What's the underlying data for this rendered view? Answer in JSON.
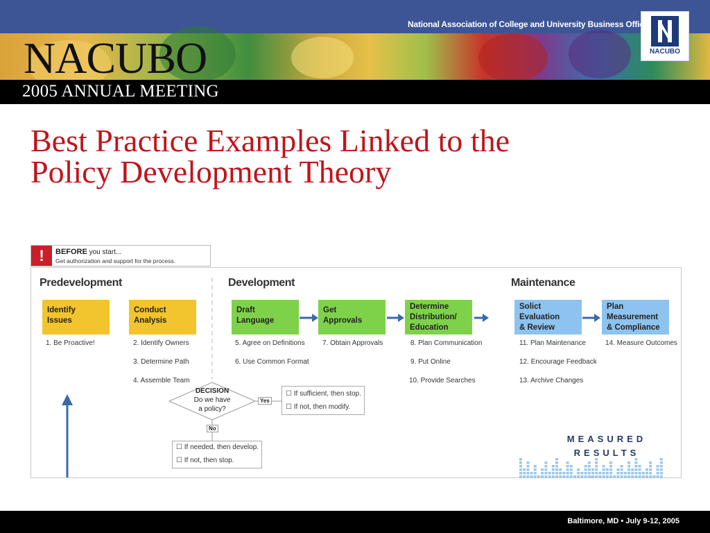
{
  "header": {
    "association": "National Association of College and University Business Officers",
    "wordmark": "NACUBO",
    "meeting": "2005 ANNUAL MEETING",
    "logo_label": "NACUBO"
  },
  "title": {
    "line1": "Best Practice Examples Linked to the",
    "line2": "Policy Development Theory"
  },
  "before": {
    "mark": "!",
    "heading": "BEFORE",
    "heading_rest": "you start...",
    "text": "Get authorization and support for the process."
  },
  "phases": {
    "predevelopment": "Predevelopment",
    "development": "Development",
    "maintenance": "Maintenance"
  },
  "steps": [
    {
      "line1": "Identify",
      "line2": "Issues",
      "line3": ""
    },
    {
      "line1": "Conduct",
      "line2": "Analysis",
      "line3": ""
    },
    {
      "line1": "Draft",
      "line2": "Language",
      "line3": ""
    },
    {
      "line1": "Get",
      "line2": "Approvals",
      "line3": ""
    },
    {
      "line1": "Determine",
      "line2": "Distribution/",
      "line3": "Education"
    },
    {
      "line1": "Solict",
      "line2": "Evaluation",
      "line3": "& Review"
    },
    {
      "line1": "Plan",
      "line2": "Measurement",
      "line3": "& Compliance"
    }
  ],
  "items": [
    "1. Be Proactive!",
    "2. Identify Owners",
    "3. Determine Path",
    "4. Assemble Team",
    "5. Agree on Definitions",
    "6. Use Common Format",
    "7. Obtain Approvals",
    "8. Plan Communication",
    "9. Put Online",
    "10. Provide Searches",
    "11. Plan Maintenance",
    "12. Encourage Feedback",
    "13. Archive Changes",
    "14. Measure Outcomes"
  ],
  "decision": {
    "title": "DECISION",
    "line1": "Do we have",
    "line2": "a policy?",
    "yes": "Yes",
    "no": "No",
    "yes_options": [
      "If sufficient, then stop.",
      "If not, then modify."
    ],
    "no_options": [
      "If needed, then develop.",
      "If not, then stop."
    ]
  },
  "measured": {
    "line1": "MEASURED",
    "line2": "RESULTS"
  },
  "footer": {
    "text": "Baltimore, MD  •  July 9-12, 2005"
  },
  "colors": {
    "title_red": "#c0141b",
    "predev_yellow": "#f2c42d",
    "dev_green": "#7ed24a",
    "maint_blue": "#8dc3ee",
    "arrow_blue": "#3a6aa8"
  }
}
